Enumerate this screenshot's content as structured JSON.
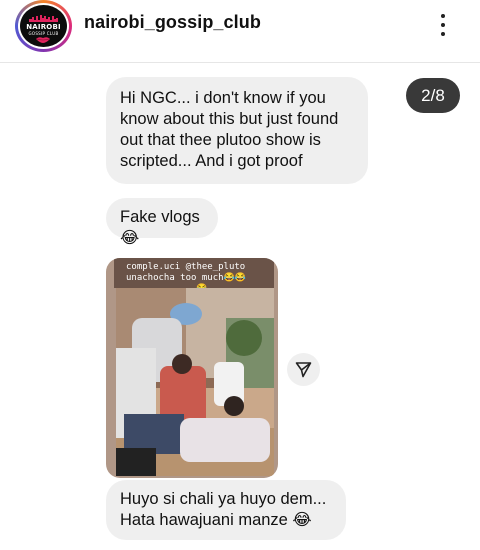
{
  "header": {
    "username": "nairobi_gossip_club",
    "avatar_text": "NAIROBI",
    "avatar_subtext": "GOSSIP CLUB"
  },
  "viewer": {
    "page_indicator": "2/8"
  },
  "messages": [
    {
      "type": "text",
      "text": "Hi NGC... i don't know if you know about this but just found out that thee plutoo show is scripted... And i got proof"
    },
    {
      "type": "text",
      "text": "Fake vlogs😂"
    },
    {
      "type": "image",
      "caption_line1": "comple.uci @thee_pluto",
      "caption_line2": "unachocha too much😂😂",
      "caption_line3": "😂"
    },
    {
      "type": "text",
      "text": "Huyo si chali ya huyo dem... Hata hawajuani manze 😂"
    }
  ],
  "icons": {
    "more": "more-vertical-icon",
    "share": "send-icon"
  },
  "colors": {
    "bubble": "#efefef",
    "badge": "#1e1e1e",
    "photo_frame": "#b09787"
  }
}
